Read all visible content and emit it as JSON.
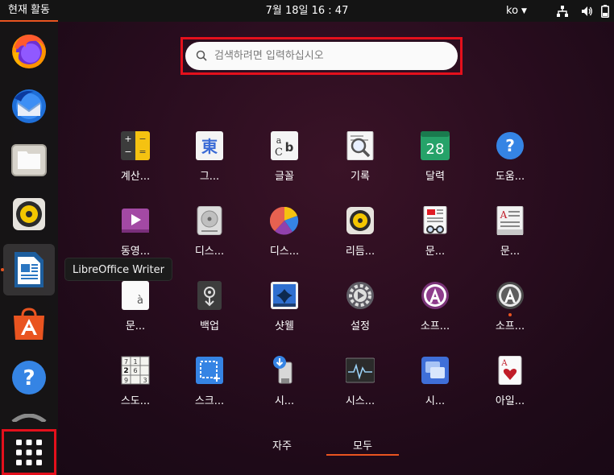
{
  "topbar": {
    "activities": "현재 활동",
    "clock": "7월 18일  16 : 47",
    "language": "ko",
    "icons": [
      "network-icon",
      "volume-icon",
      "battery-icon"
    ]
  },
  "dock": {
    "items": [
      {
        "name": "firefox-icon"
      },
      {
        "name": "thunderbird-icon"
      },
      {
        "name": "files-icon"
      },
      {
        "name": "rhythmbox-icon"
      },
      {
        "name": "libreoffice-writer-icon"
      },
      {
        "name": "software-icon"
      },
      {
        "name": "help-icon"
      }
    ],
    "show_apps_icon": "grid-icon"
  },
  "tooltip": "LibreOffice Writer",
  "search": {
    "placeholder": "검색하려면 입력하십시오",
    "value": ""
  },
  "apps": [
    {
      "label": "계산...",
      "icon": "calculator-icon"
    },
    {
      "label": "그...",
      "icon": "character-map-icon"
    },
    {
      "label": "글꼴",
      "icon": "fonts-icon"
    },
    {
      "label": "기록",
      "icon": "logs-icon"
    },
    {
      "label": "달력",
      "icon": "calendar-icon",
      "calendar_day": "28"
    },
    {
      "label": "도움...",
      "icon": "help-icon"
    },
    {
      "label": "동영...",
      "icon": "videos-icon"
    },
    {
      "label": "디스...",
      "icon": "disks-icon"
    },
    {
      "label": "디스...",
      "icon": "disk-usage-icon"
    },
    {
      "label": "리듬...",
      "icon": "rhythmbox-icon"
    },
    {
      "label": "문...",
      "icon": "document-viewer-icon"
    },
    {
      "label": "문...",
      "icon": "text-editor-icon"
    },
    {
      "label": "문...",
      "icon": "libreoffice-writer-icon"
    },
    {
      "label": "백업",
      "icon": "backup-icon"
    },
    {
      "label": "샷웰",
      "icon": "shotwell-icon"
    },
    {
      "label": "설정",
      "icon": "settings-icon"
    },
    {
      "label": "소프...",
      "icon": "software-updater-icon"
    },
    {
      "label": "소프...",
      "icon": "software-properties-icon"
    },
    {
      "label": "스도...",
      "icon": "sudoku-icon"
    },
    {
      "label": "스크...",
      "icon": "screenshot-icon"
    },
    {
      "label": "시...",
      "icon": "startup-disk-icon"
    },
    {
      "label": "시스...",
      "icon": "system-monitor-icon"
    },
    {
      "label": "시...",
      "icon": "remote-desktop-icon"
    },
    {
      "label": "아일...",
      "icon": "aisleriot-icon"
    }
  ],
  "tabs": {
    "frequent": "자주",
    "all": "모두",
    "active": "all"
  },
  "colors": {
    "accent": "#e95420",
    "highlight_box": "#e4101c",
    "panel": "#141414"
  }
}
